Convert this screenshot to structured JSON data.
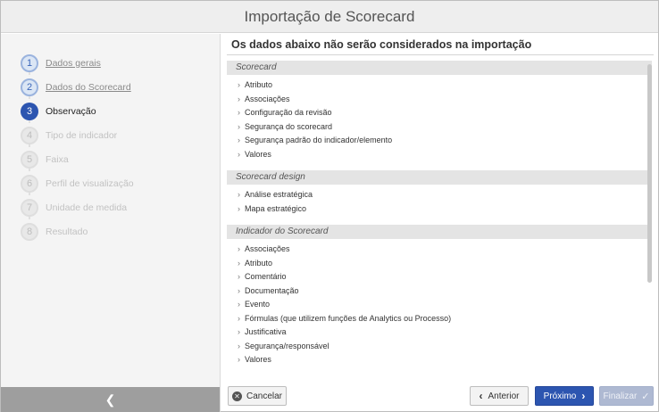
{
  "window": {
    "title": "Importação de Scorecard"
  },
  "steps": [
    {
      "num": "1",
      "label": "Dados gerais",
      "state": "done"
    },
    {
      "num": "2",
      "label": "Dados do Scorecard",
      "state": "done"
    },
    {
      "num": "3",
      "label": "Observação",
      "state": "current"
    },
    {
      "num": "4",
      "label": "Tipo de indicador",
      "state": "future"
    },
    {
      "num": "5",
      "label": "Faixa",
      "state": "future"
    },
    {
      "num": "6",
      "label": "Perfil de visualização",
      "state": "future"
    },
    {
      "num": "7",
      "label": "Unidade de medida",
      "state": "future"
    },
    {
      "num": "8",
      "label": "Resultado",
      "state": "future"
    }
  ],
  "main": {
    "title": "Os dados abaixo não serão considerados na importação",
    "sections": [
      {
        "header": "Scorecard",
        "items": [
          "Atributo",
          "Associações",
          "Configuração da revisão",
          "Segurança do scorecard",
          "Segurança padrão do indicador/elemento",
          "Valores"
        ]
      },
      {
        "header": "Scorecard design",
        "items": [
          "Análise estratégica",
          "Mapa estratégico"
        ]
      },
      {
        "header": "Indicador do Scorecard",
        "items": [
          "Associações",
          "Atributo",
          "Comentário",
          "Documentação",
          "Evento",
          "Fórmulas (que utilizem funções de Analytics ou Processo)",
          "Justificativa",
          "Segurança/responsável",
          "Valores"
        ]
      }
    ]
  },
  "footer": {
    "cancel_label": "Cancelar",
    "prev_label": "Anterior",
    "next_label": "Próximo",
    "finish_label": "Finalizar"
  },
  "icons": {
    "collapse": "chevron-left-icon",
    "cancel": "close-circle-icon",
    "prev": "chevron-left-icon",
    "next": "chevron-right-icon",
    "finish": "check-icon"
  },
  "colors": {
    "accent": "#2c55b0",
    "finish_disabled": "#aeb9d2",
    "sidebar_bg": "#f4f4f4",
    "collapse_bar": "#9e9e9e"
  }
}
